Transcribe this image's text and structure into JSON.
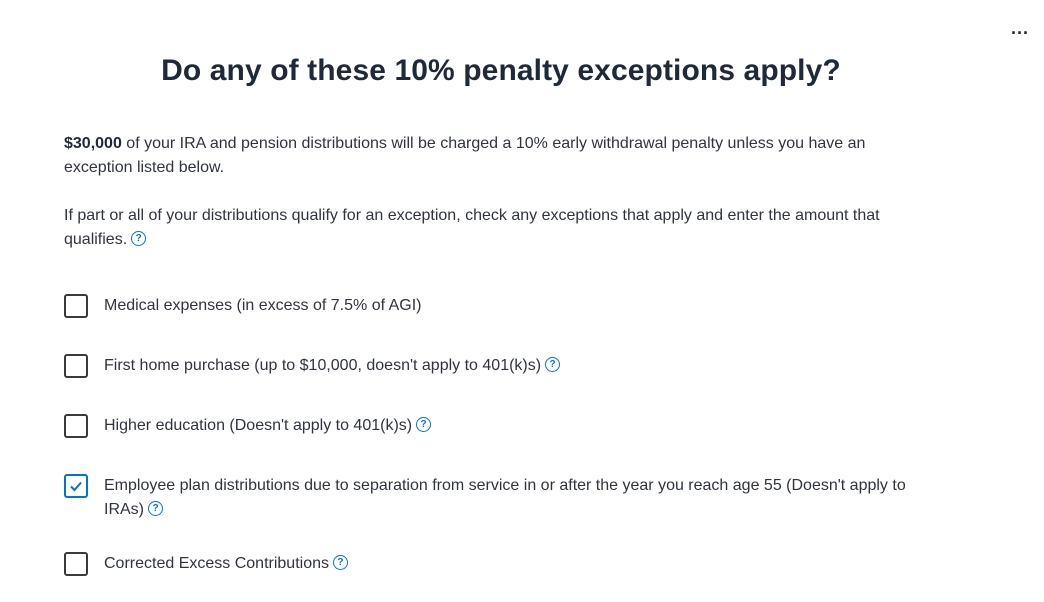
{
  "menu": {
    "more_icon": "ellipsis-icon",
    "more_label": "..."
  },
  "page": {
    "title": "Do any of these 10% penalty exceptions apply?",
    "intro_amount": "$30,000",
    "intro_text": " of your IRA and pension distributions will be charged a 10% early withdrawal penalty unless you have an exception listed below.",
    "instructions": "If part or all of your distributions qualify for an exception, check any exceptions that apply and enter the amount that qualifies."
  },
  "help_icon": {
    "glyph": "?",
    "name": "help-icon",
    "color": "#0077c5"
  },
  "options": [
    {
      "label": "Medical expenses (in excess of 7.5% of AGI)",
      "checked": false,
      "help": false
    },
    {
      "label": "First home purchase (up to $10,000, doesn't apply to 401(k)s)",
      "checked": false,
      "help": true
    },
    {
      "label": "Higher education (Doesn't apply to 401(k)s)",
      "checked": false,
      "help": true
    },
    {
      "label": "Employee plan distributions due to separation from service in or after the year you reach age 55 (Doesn't apply to IRAs)",
      "checked": true,
      "help": true
    },
    {
      "label": "Corrected Excess Contributions",
      "checked": false,
      "help": true
    }
  ]
}
